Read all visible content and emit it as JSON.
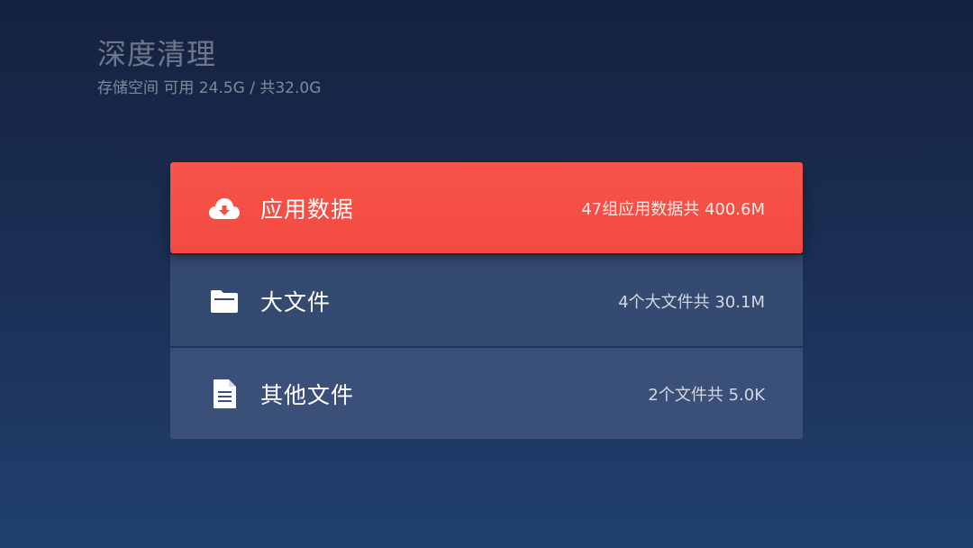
{
  "header": {
    "title": "深度清理",
    "storage": "存储空间 可用 24.5G / 共32.0G"
  },
  "items": [
    {
      "label": "应用数据",
      "detail": "47组应用数据共 400.6M",
      "icon": "cloud-download-icon",
      "selected": true
    },
    {
      "label": "大文件",
      "detail": "4个大文件共 30.1M",
      "icon": "folder-icon",
      "selected": false
    },
    {
      "label": "其他文件",
      "detail": "2个文件共 5.0K",
      "icon": "document-icon",
      "selected": false
    }
  ],
  "colors": {
    "selected_row": "#f54f45",
    "row": "#344a70",
    "background_top": "#15223f",
    "background_bottom": "#21406f"
  }
}
